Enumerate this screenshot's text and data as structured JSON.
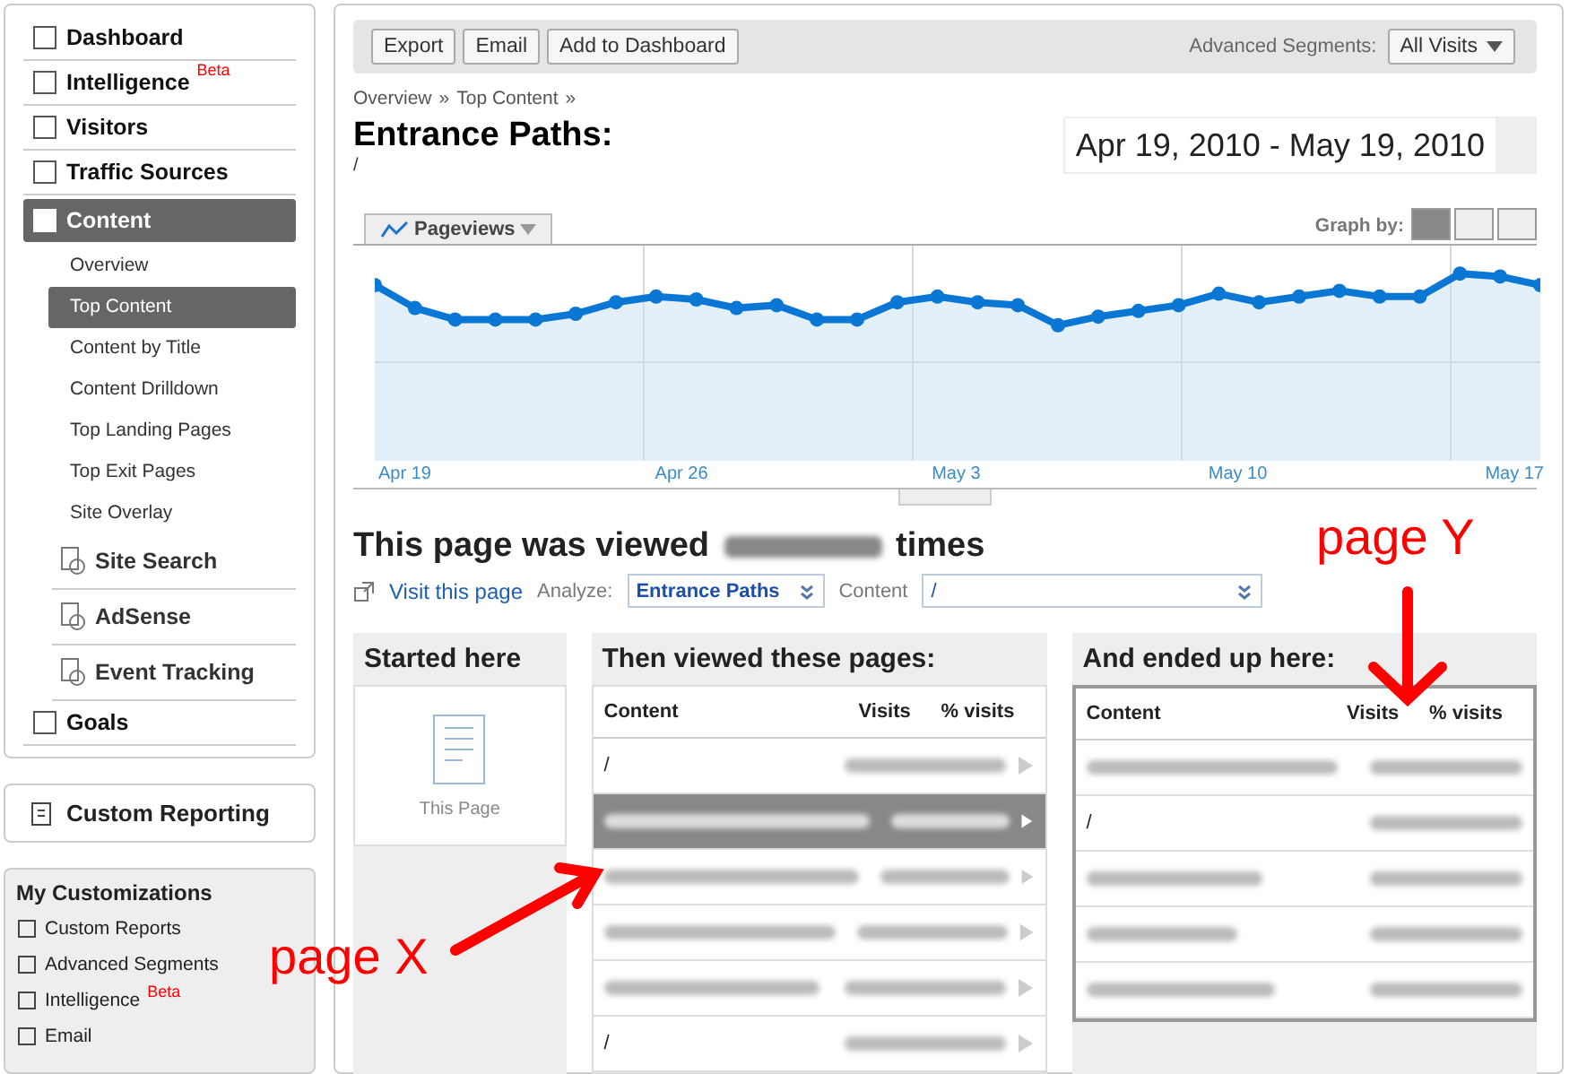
{
  "sidebar": {
    "items": [
      {
        "kind": "main",
        "label": "Dashboard",
        "selected": false
      },
      {
        "kind": "main",
        "label": "Intelligence",
        "badge": "Beta",
        "selected": false
      },
      {
        "kind": "main",
        "label": "Visitors",
        "selected": false
      },
      {
        "kind": "main",
        "label": "Traffic Sources",
        "selected": false
      },
      {
        "kind": "main",
        "label": "Content",
        "selected": true
      },
      {
        "kind": "sub",
        "label": "Overview",
        "selected": false
      },
      {
        "kind": "sub",
        "label": "Top Content",
        "selected": true
      },
      {
        "kind": "sub",
        "label": "Content by Title",
        "selected": false
      },
      {
        "kind": "sub",
        "label": "Content Drilldown",
        "selected": false
      },
      {
        "kind": "sub",
        "label": "Top Landing Pages",
        "selected": false
      },
      {
        "kind": "sub",
        "label": "Top Exit Pages",
        "selected": false
      },
      {
        "kind": "sub",
        "label": "Site Overlay",
        "selected": false
      },
      {
        "kind": "section",
        "label": "Site Search",
        "selected": false
      },
      {
        "kind": "section",
        "label": "AdSense",
        "selected": false
      },
      {
        "kind": "section",
        "label": "Event Tracking",
        "selected": false
      },
      {
        "kind": "main",
        "label": "Goals",
        "selected": false
      }
    ],
    "custom_reporting": "Custom Reporting",
    "my_customizations": {
      "title": "My Customizations",
      "items": [
        {
          "label": "Custom Reports"
        },
        {
          "label": "Advanced Segments"
        },
        {
          "label": "Intelligence",
          "badge": "Beta"
        },
        {
          "label": "Email"
        }
      ]
    }
  },
  "toolbar": {
    "buttons": [
      "Export",
      "Email",
      "Add to Dashboard"
    ],
    "segments_label": "Advanced Segments:",
    "segments_value": "All Visits"
  },
  "breadcrumb": [
    "Overview",
    "Top Content"
  ],
  "breadcrumb_separator": "»",
  "title": "Entrance Paths:",
  "subtitle": "/",
  "date_range": "Apr 19, 2010 - May 19, 2010",
  "graph": {
    "metric": "Pageviews",
    "graph_by_label": "Graph by:",
    "x_labels": [
      "Apr 19",
      "Apr 26",
      "May 3",
      "May 10",
      "May 17"
    ]
  },
  "summary": {
    "before": "This page was viewed",
    "after": "times"
  },
  "controls": {
    "visit_link": "Visit this page",
    "analyze_label": "Analyze:",
    "analyze_value": "Entrance Paths",
    "content_label": "Content",
    "content_value": "/"
  },
  "started": {
    "title": "Started here",
    "page_label": "This Page"
  },
  "then_viewed": {
    "title": "Then viewed these pages:",
    "columns": [
      "Content",
      "Visits",
      "% visits"
    ],
    "rows": [
      {
        "content": "/",
        "selected": false
      },
      {
        "selected": true
      },
      {
        "selected": false
      },
      {
        "selected": false
      },
      {
        "selected": false
      },
      {
        "content": "/",
        "selected": false
      }
    ]
  },
  "ended": {
    "title": "And ended up here:",
    "columns": [
      "Content",
      "Visits",
      "% visits"
    ],
    "rows": [
      {},
      {
        "content": "/"
      },
      {},
      {},
      {}
    ]
  },
  "annotations": [
    "page X",
    "page Y"
  ]
}
